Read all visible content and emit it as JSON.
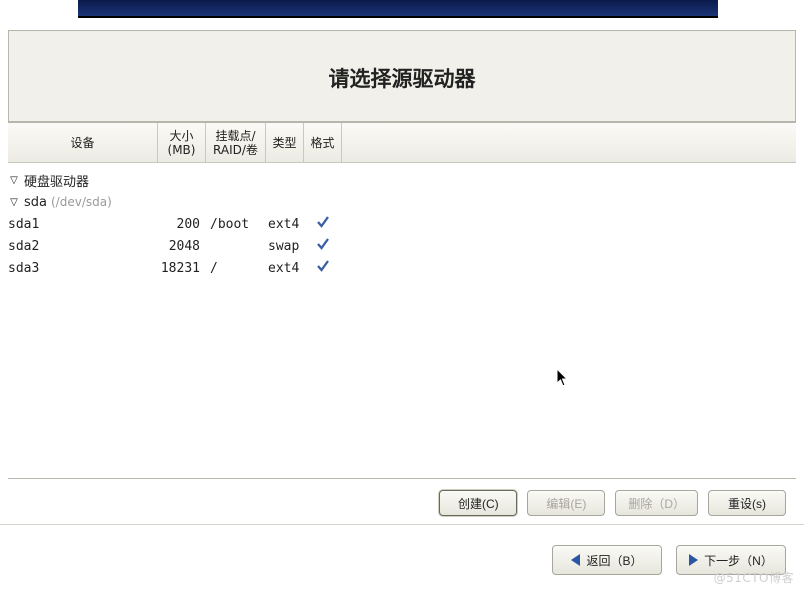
{
  "title": "请选择源驱动器",
  "columns": {
    "device": "设备",
    "size": "大小\n(MB)",
    "mount": "挂载点/\nRAID/卷",
    "type": "类型",
    "format": "格式"
  },
  "tree": {
    "root_label": "硬盘驱动器",
    "disk": {
      "name": "sda",
      "path": "(/dev/sda)",
      "partitions": [
        {
          "name": "sda1",
          "size": "200",
          "mount": "/boot",
          "type": "ext4",
          "format": true
        },
        {
          "name": "sda2",
          "size": "2048",
          "mount": "",
          "type": "swap",
          "format": true
        },
        {
          "name": "sda3",
          "size": "18231",
          "mount": "/",
          "type": "ext4",
          "format": true
        }
      ]
    }
  },
  "buttons": {
    "create": "创建(C)",
    "edit": "编辑(E)",
    "delete": "删除（D）",
    "reset": "重设(s)",
    "back": "返回（B）",
    "next": "下一步（N）"
  },
  "watermark": "@51CTO博客"
}
